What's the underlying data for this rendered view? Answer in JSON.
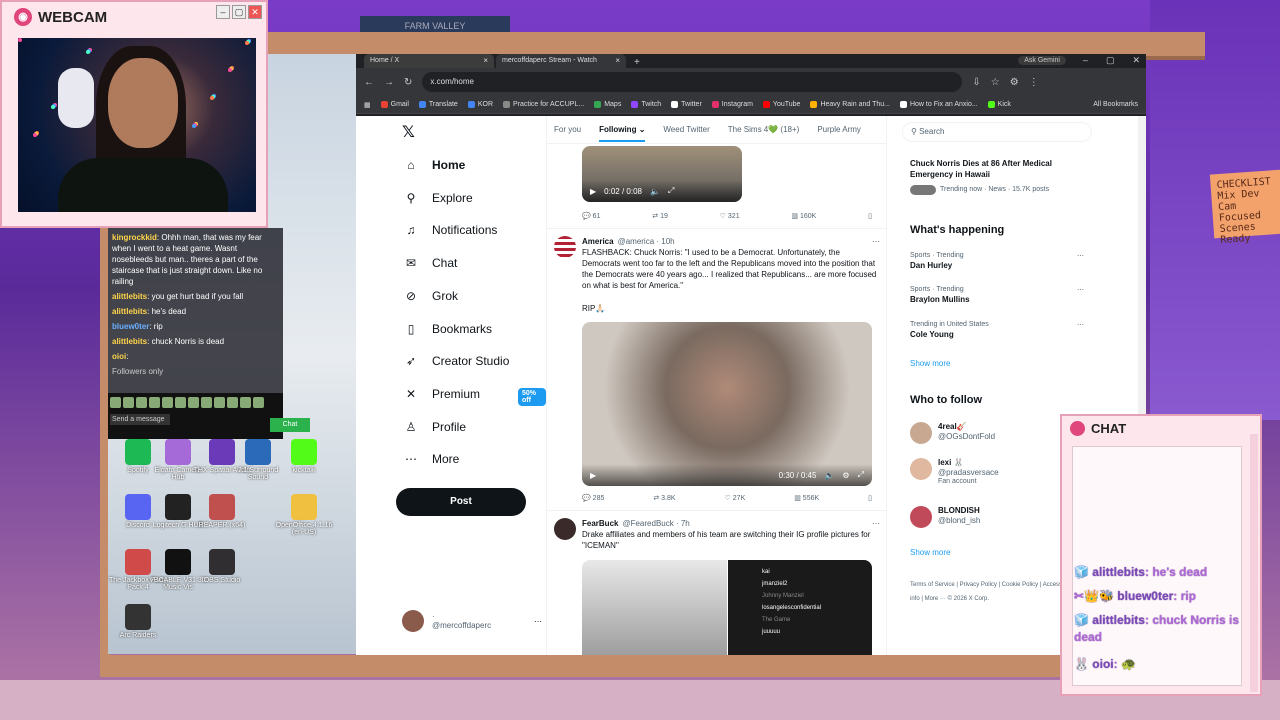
{
  "webcam": {
    "title": "WEBCAM"
  },
  "left_chat": {
    "messages": [
      {
        "user": "kingrockkid",
        "text": "Ohhh man, that was my fear when I went to a heat game. Wasnt nosebleeds but man.. theres a part of the staircase that is just straight down. Like no railing",
        "color": "#ffd54a"
      },
      {
        "user": "alittlebits",
        "text": "you get hurt bad if you fall",
        "color": "#ffd54a"
      },
      {
        "user": "alittlebits",
        "text": "he's dead",
        "color": "#ffd54a"
      },
      {
        "user": "bluew0ter",
        "text": "rip",
        "color": "#6ab0ff"
      },
      {
        "user": "alittlebits",
        "text": "chuck Norris is dead",
        "color": "#ffd54a"
      },
      {
        "user": "oioi",
        "text": "",
        "color": "#ffd54a"
      }
    ],
    "followers_only": "Followers only",
    "send_placeholder": "Send a message",
    "chat_button": "Chat"
  },
  "desktop_icons": [
    {
      "label": "Spotify",
      "color": "#1db954"
    },
    {
      "label": "Elgato Camera Hub",
      "color": "#a66ad8"
    },
    {
      "label": "THX Spatial Audio",
      "color": "#6a3ab8"
    },
    {
      "label": "7.1 Surround Sound",
      "color": "#2a6ab8"
    },
    {
      "label": "kicktalk",
      "color": "#53fc18"
    },
    {
      "label": "Discord",
      "color": "#5865f2"
    },
    {
      "label": "Logitech G HUB",
      "color": "#222222"
    },
    {
      "label": "REAPER (x64)",
      "color": "#c0504d"
    },
    {
      "label": "OpenOffice 4.1.16 (en-US)",
      "color": "#f0c040"
    },
    {
      "label": "The Jackbox Party Pack 4",
      "color": "#d04a4a"
    },
    {
      "label": "VBCABLE V31 3D Music Vis",
      "color": "#111111"
    },
    {
      "label": "OBS Studio",
      "color": "#302e31"
    },
    {
      "label": "Arc Raiders",
      "color": "#333333"
    }
  ],
  "browser": {
    "tabs": [
      {
        "label": "Home / X"
      },
      {
        "label": "mercoffdaperc Stream - Watch"
      }
    ],
    "ask_gemini": "Ask Gemini",
    "url": "x.com/home",
    "bookmarks": [
      {
        "label": "Gmail",
        "color": "#ea4335"
      },
      {
        "label": "Translate",
        "color": "#4285f4"
      },
      {
        "label": "KOR",
        "color": "#4285f4"
      },
      {
        "label": "Practice for ACCUPL...",
        "color": "#888888"
      },
      {
        "label": "Maps",
        "color": "#34a853"
      },
      {
        "label": "Twitch",
        "color": "#9146ff"
      },
      {
        "label": "Twitter",
        "color": "#ffffff"
      },
      {
        "label": "Instagram",
        "color": "#e1306c"
      },
      {
        "label": "YouTube",
        "color": "#ff0000"
      },
      {
        "label": "Heavy Rain and Thu...",
        "color": "#ffb300"
      },
      {
        "label": "How to Fix an Anxio...",
        "color": "#ffffff"
      },
      {
        "label": "Kick",
        "color": "#53fc18"
      }
    ],
    "all_bookmarks": "All Bookmarks"
  },
  "x": {
    "nav": [
      {
        "label": "Home",
        "icon": "home-icon",
        "glyph": "⌂"
      },
      {
        "label": "Explore",
        "icon": "search-icon",
        "glyph": "⚲"
      },
      {
        "label": "Notifications",
        "icon": "bell-icon",
        "glyph": "♫"
      },
      {
        "label": "Chat",
        "icon": "mail-icon",
        "glyph": "✉"
      },
      {
        "label": "Grok",
        "icon": "grok-icon",
        "glyph": "⊘"
      },
      {
        "label": "Bookmarks",
        "icon": "bookmark-icon",
        "glyph": "▯"
      },
      {
        "label": "Creator Studio",
        "icon": "rocket-icon",
        "glyph": "➶"
      },
      {
        "label": "Premium",
        "icon": "x-icon",
        "glyph": "✕"
      },
      {
        "label": "Profile",
        "icon": "person-icon",
        "glyph": "♙"
      },
      {
        "label": "More",
        "icon": "more-icon",
        "glyph": "⋯"
      }
    ],
    "premium_badge": "50% off",
    "post_button": "Post",
    "account": {
      "name": "·",
      "handle": "@mercoffdaperc"
    },
    "feed_tabs": [
      "For you",
      "Following",
      "Weed Twitter",
      "The Sims 4💚 (18+)",
      "Purple Army"
    ],
    "top_video": {
      "time": "0:02 / 0:08"
    },
    "top_actions": {
      "replies": "61",
      "reposts": "19",
      "likes": "321",
      "views": "160K"
    },
    "tweet1": {
      "name": "America",
      "handle": "@america · 10h",
      "text": "FLASHBACK: Chuck Norris: \"I used to be a Democrat. Unfortunately, the Democrats went too far to the left and the Republicans moved into the position that the Democrats were 40 years ago... I realized that Republicans... are more focused on what is best for America.\"",
      "rip": "RIP🙏🏻",
      "video_time": "0:30 / 0:45",
      "replies": "285",
      "reposts": "3.8K",
      "likes": "27K",
      "views": "556K"
    },
    "tweet2": {
      "name": "FearBuck",
      "handle": "@FearedBuck · 7h",
      "text": "Drake affiliates and members of his team are switching their IG profile pictures for \"ICEMAN\"",
      "list": [
        "kai",
        "jmanziel2",
        "Johnny Manziel",
        "losangelesconfidential",
        "The Game",
        "juuuuu"
      ]
    },
    "search_placeholder": "Search",
    "news": {
      "title": "Chuck Norris Dies at 86 After Medical Emergency in Hawaii",
      "meta": "Trending now · News · 15.7K posts"
    },
    "whats_happening": "What's happening",
    "trends": [
      {
        "context": "Sports · Trending",
        "name": "Dan Hurley"
      },
      {
        "context": "Sports · Trending",
        "name": "Braylon Mullins"
      },
      {
        "context": "Trending in United States",
        "name": "Cole Young"
      }
    ],
    "show_more": "Show more",
    "who_to_follow": "Who to follow",
    "follows": [
      {
        "name": "4real🎸",
        "handle": "@OGsDontFold",
        "extra": "",
        "color": "#c8a890"
      },
      {
        "name": "lexi 🐰",
        "handle": "@pradasversace",
        "extra": "Fan account",
        "color": "#e0b8a0"
      },
      {
        "name": "BLONDISH",
        "handle": "@blond_ish",
        "extra": "",
        "color": "#c04a5a"
      }
    ],
    "show_more2": "Show more",
    "footer": "Terms of Service | Privacy Policy | Cookie Policy | Accessibility | Ads info | More ··· © 2026 X Corp."
  },
  "right_chat": {
    "title": "CHAT",
    "messages": [
      {
        "user": "alittlebits",
        "text": "he's dead"
      },
      {
        "user": "bluew0ter",
        "text": "rip"
      },
      {
        "user": "alittlebits",
        "text": "chuck Norris is dead"
      },
      {
        "user": "oioi",
        "text": "🐢"
      }
    ]
  },
  "room": {
    "sign": "FARM VALLEY",
    "note": "CHECKLIST Mix Dev Cam Focused Scenes Ready"
  }
}
